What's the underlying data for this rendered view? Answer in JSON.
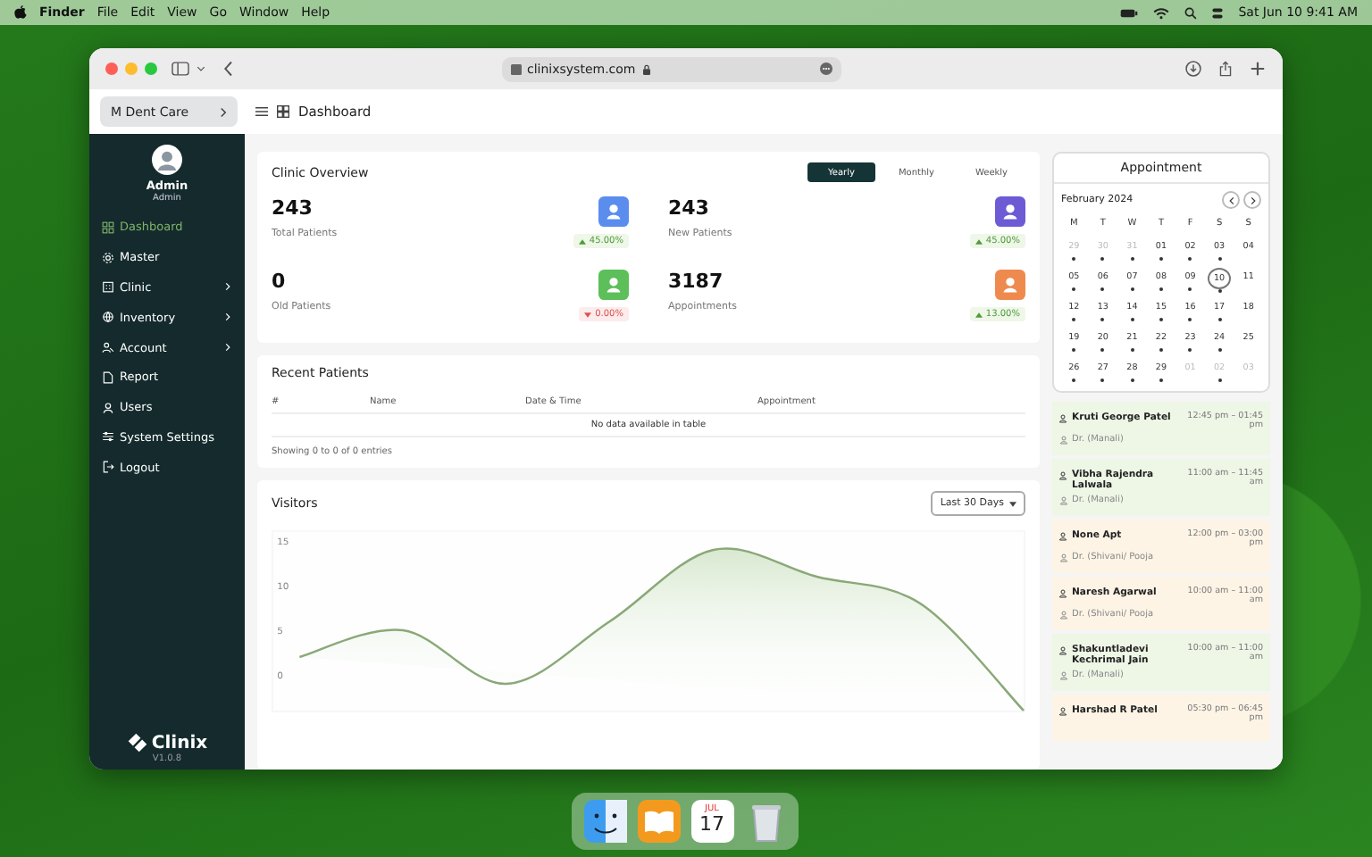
{
  "menubar": {
    "app": "Finder",
    "menus": [
      "File",
      "Edit",
      "View",
      "Go",
      "Window",
      "Help"
    ],
    "clock": "Sat Jun 10  9:41 AM"
  },
  "browser": {
    "url": "clinixsystem.com"
  },
  "header": {
    "clinic": "M Dent Care",
    "page": "Dashboard"
  },
  "sidebar": {
    "user_name": "Admin",
    "user_role": "Admin",
    "logo": "Clinix",
    "version": "V1.0.8",
    "items": [
      {
        "label": "Dashboard",
        "selected": true,
        "submenu": false
      },
      {
        "label": "Master",
        "selected": false,
        "submenu": false
      },
      {
        "label": "Clinic",
        "selected": false,
        "submenu": true
      },
      {
        "label": "Inventory",
        "selected": false,
        "submenu": true
      },
      {
        "label": "Account",
        "selected": false,
        "submenu": true
      },
      {
        "label": "Report",
        "selected": false,
        "submenu": false
      },
      {
        "label": "Users",
        "selected": false,
        "submenu": false
      },
      {
        "label": "System Settings",
        "selected": false,
        "submenu": false
      },
      {
        "label": "Logout",
        "selected": false,
        "submenu": false
      }
    ]
  },
  "overview": {
    "title": "Clinic Overview",
    "periods": [
      {
        "label": "Yearly",
        "selected": true
      },
      {
        "label": "Monthly",
        "selected": false
      },
      {
        "label": "Weekly",
        "selected": false
      }
    ],
    "stats": [
      {
        "value": "243",
        "label": "Total Patients",
        "change": "45.00%",
        "rising": true,
        "color": "#5b8def"
      },
      {
        "value": "243",
        "label": "New Patients",
        "change": "45.00%",
        "rising": true,
        "color": "#6c5bd4"
      },
      {
        "value": "0",
        "label": "Old Patients",
        "change": "0.00%",
        "rising": false,
        "color": "#5cbf5a"
      },
      {
        "value": "3187",
        "label": "Appointments",
        "change": "13.00%",
        "rising": true,
        "color": "#ef8a4e"
      }
    ]
  },
  "recent_patients": {
    "title": "Recent Patients",
    "columns": [
      "#",
      "Name",
      "Date & Time",
      "Appointment"
    ],
    "empty": "No data available in table",
    "info": "Showing 0 to 0 of 0 entries"
  },
  "visitors": {
    "title": "Visitors",
    "range": "Last 30 Days",
    "chart_data": {
      "type": "line",
      "categories": [
        null,
        null,
        null,
        null,
        null,
        null,
        null,
        null
      ],
      "series": [
        {
          "color": "#8aa878",
          "values": [
            2,
            5,
            -1,
            6,
            14,
            11,
            8,
            -4
          ]
        }
      ],
      "ylim": [
        -4,
        16
      ],
      "yticks": [
        0,
        5,
        10,
        15
      ]
    }
  },
  "appointment": {
    "title": "Appointment",
    "month": "February 2024",
    "weekdays": [
      "M",
      "T",
      "W",
      "T",
      "F",
      "S",
      "S"
    ],
    "days": [
      {
        "label": "29",
        "muted": true,
        "dot": true,
        "selected": false
      },
      {
        "label": "30",
        "muted": true,
        "dot": true,
        "selected": false
      },
      {
        "label": "31",
        "muted": true,
        "dot": true,
        "selected": false
      },
      {
        "label": "01",
        "muted": false,
        "dot": true,
        "selected": false
      },
      {
        "label": "02",
        "muted": false,
        "dot": true,
        "selected": false
      },
      {
        "label": "03",
        "muted": false,
        "dot": true,
        "selected": false
      },
      {
        "label": "04",
        "muted": false,
        "dot": false,
        "selected": false
      },
      {
        "label": "05",
        "muted": false,
        "dot": true,
        "selected": false
      },
      {
        "label": "06",
        "muted": false,
        "dot": true,
        "selected": false
      },
      {
        "label": "07",
        "muted": false,
        "dot": true,
        "selected": false
      },
      {
        "label": "08",
        "muted": false,
        "dot": true,
        "selected": false
      },
      {
        "label": "09",
        "muted": false,
        "dot": true,
        "selected": false
      },
      {
        "label": "10",
        "muted": false,
        "dot": true,
        "selected": true
      },
      {
        "label": "11",
        "muted": false,
        "dot": false,
        "selected": false
      },
      {
        "label": "12",
        "muted": false,
        "dot": true,
        "selected": false
      },
      {
        "label": "13",
        "muted": false,
        "dot": true,
        "selected": false
      },
      {
        "label": "14",
        "muted": false,
        "dot": true,
        "selected": false
      },
      {
        "label": "15",
        "muted": false,
        "dot": true,
        "selected": false
      },
      {
        "label": "16",
        "muted": false,
        "dot": true,
        "selected": false
      },
      {
        "label": "17",
        "muted": false,
        "dot": true,
        "selected": false
      },
      {
        "label": "18",
        "muted": false,
        "dot": false,
        "selected": false
      },
      {
        "label": "19",
        "muted": false,
        "dot": true,
        "selected": false
      },
      {
        "label": "20",
        "muted": false,
        "dot": true,
        "selected": false
      },
      {
        "label": "21",
        "muted": false,
        "dot": true,
        "selected": false
      },
      {
        "label": "22",
        "muted": false,
        "dot": true,
        "selected": false
      },
      {
        "label": "23",
        "muted": false,
        "dot": true,
        "selected": false
      },
      {
        "label": "24",
        "muted": false,
        "dot": true,
        "selected": false
      },
      {
        "label": "25",
        "muted": false,
        "dot": false,
        "selected": false
      },
      {
        "label": "26",
        "muted": false,
        "dot": true,
        "selected": false
      },
      {
        "label": "27",
        "muted": false,
        "dot": true,
        "selected": false
      },
      {
        "label": "28",
        "muted": false,
        "dot": true,
        "selected": false
      },
      {
        "label": "29",
        "muted": false,
        "dot": true,
        "selected": false
      },
      {
        "label": "01",
        "muted": true,
        "dot": false,
        "selected": false
      },
      {
        "label": "02",
        "muted": true,
        "dot": true,
        "selected": false
      },
      {
        "label": "03",
        "muted": true,
        "dot": false,
        "selected": false
      }
    ],
    "entries": [
      {
        "patient": "Kruti George Patel",
        "time": "12:45 pm – 01:45 pm",
        "doctor": "Dr. (Manali)",
        "color": "#eef6e6"
      },
      {
        "patient": "Vibha Rajendra Lalwala",
        "time": "11:00 am – 11:45 am",
        "doctor": "Dr. (Manali)",
        "color": "#eef6e6"
      },
      {
        "patient": "None Apt",
        "time": "12:00 pm – 03:00 pm",
        "doctor": "Dr. (Shivani/ Pooja",
        "color": "#fdf4e6"
      },
      {
        "patient": "Naresh Agarwal",
        "time": "10:00 am – 11:00 am",
        "doctor": "Dr. (Shivani/ Pooja",
        "color": "#fdf4e6"
      },
      {
        "patient": "Shakuntladevi Kechrimal Jain",
        "time": "10:00 am – 11:00 am",
        "doctor": "Dr. (Manali)",
        "color": "#eef6e6"
      },
      {
        "patient": "Harshad R Patel",
        "time": "05:30 pm – 06:45 pm",
        "color": "#fdf4e6"
      }
    ]
  },
  "dock": {
    "calendar_month": "JUL",
    "calendar_day": "17"
  }
}
